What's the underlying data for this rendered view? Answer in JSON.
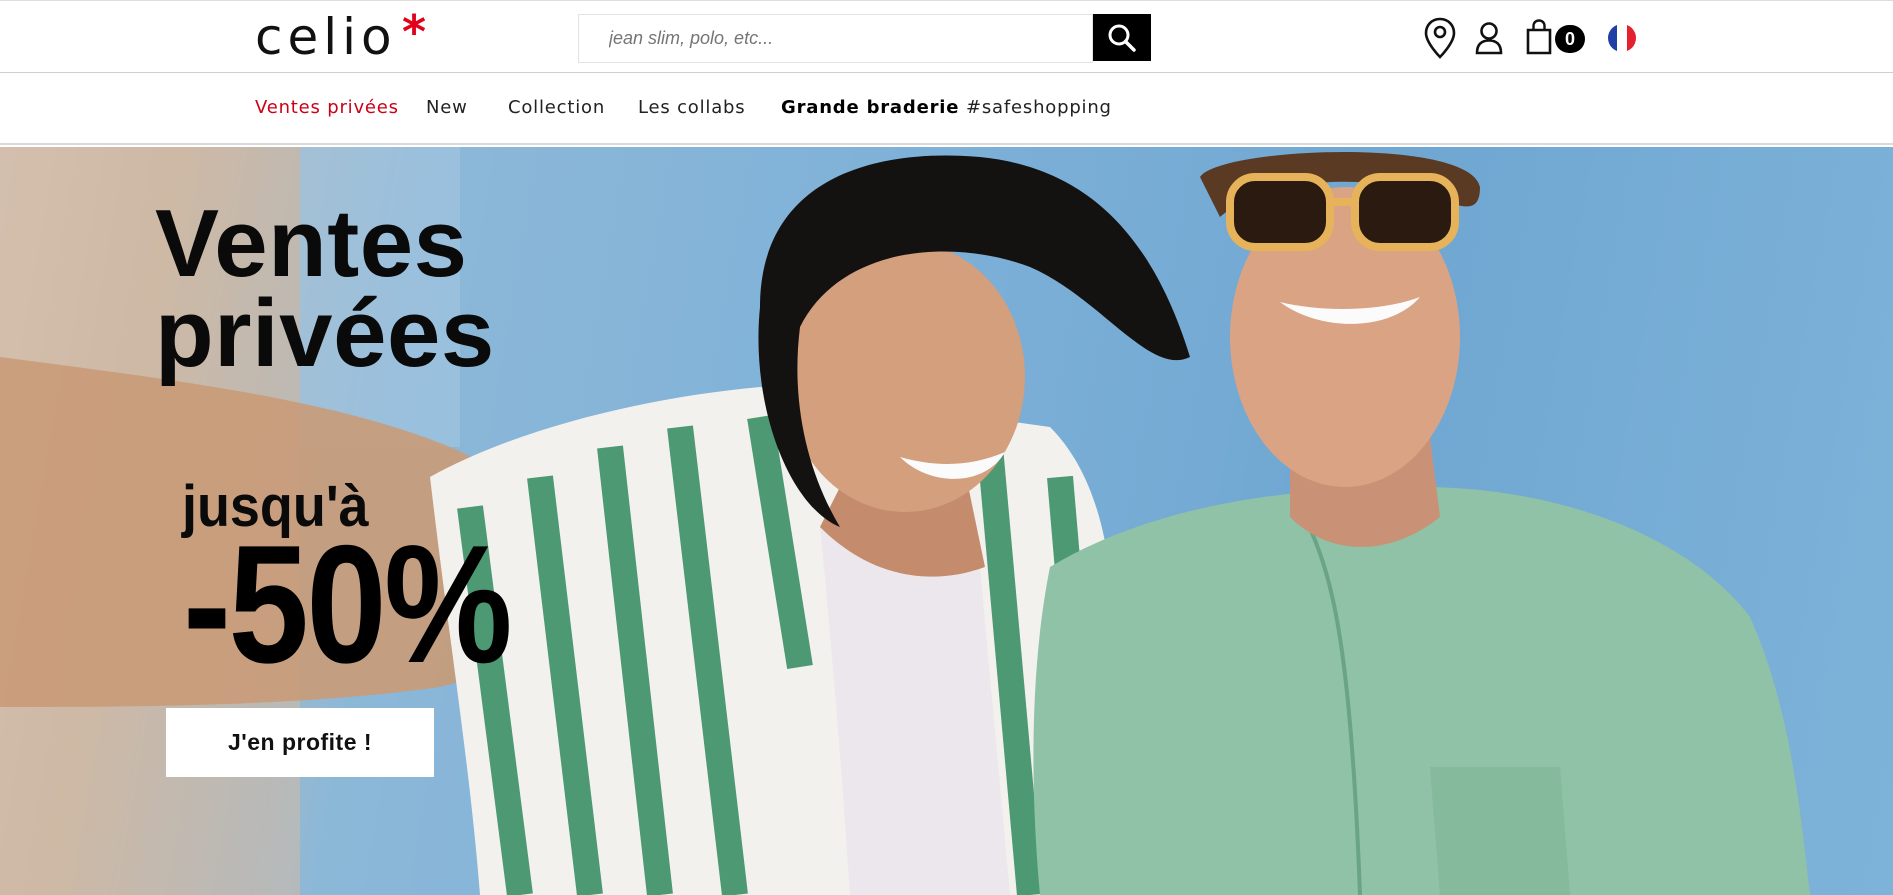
{
  "header": {
    "logo_text": "celio",
    "logo_star": "*",
    "search": {
      "placeholder": "jean slim, polo, etc...",
      "value": ""
    },
    "cart_count": "0",
    "icons": [
      "location-pin-icon",
      "user-account-icon",
      "shopping-bag-icon",
      "france-flag-icon",
      "search-icon"
    ]
  },
  "nav": {
    "items": [
      {
        "label": "Ventes privées",
        "style": "red"
      },
      {
        "label": "New",
        "style": "normal"
      },
      {
        "label": "Collection",
        "style": "normal"
      },
      {
        "label": "Les collabs",
        "style": "normal"
      },
      {
        "label": "Grande braderie",
        "style": "bold"
      },
      {
        "label": "#safeshopping",
        "style": "normal"
      }
    ]
  },
  "hero": {
    "title": "Ventes privées",
    "upto": "jusqu'à",
    "discount": "-50%",
    "cta_label": "J'en profite !"
  },
  "colors": {
    "brand_red": "#e3001b",
    "nav_red": "#cc0016",
    "hero_sky": "#7fb1d8",
    "shirt_green": "#8fc2a6"
  }
}
